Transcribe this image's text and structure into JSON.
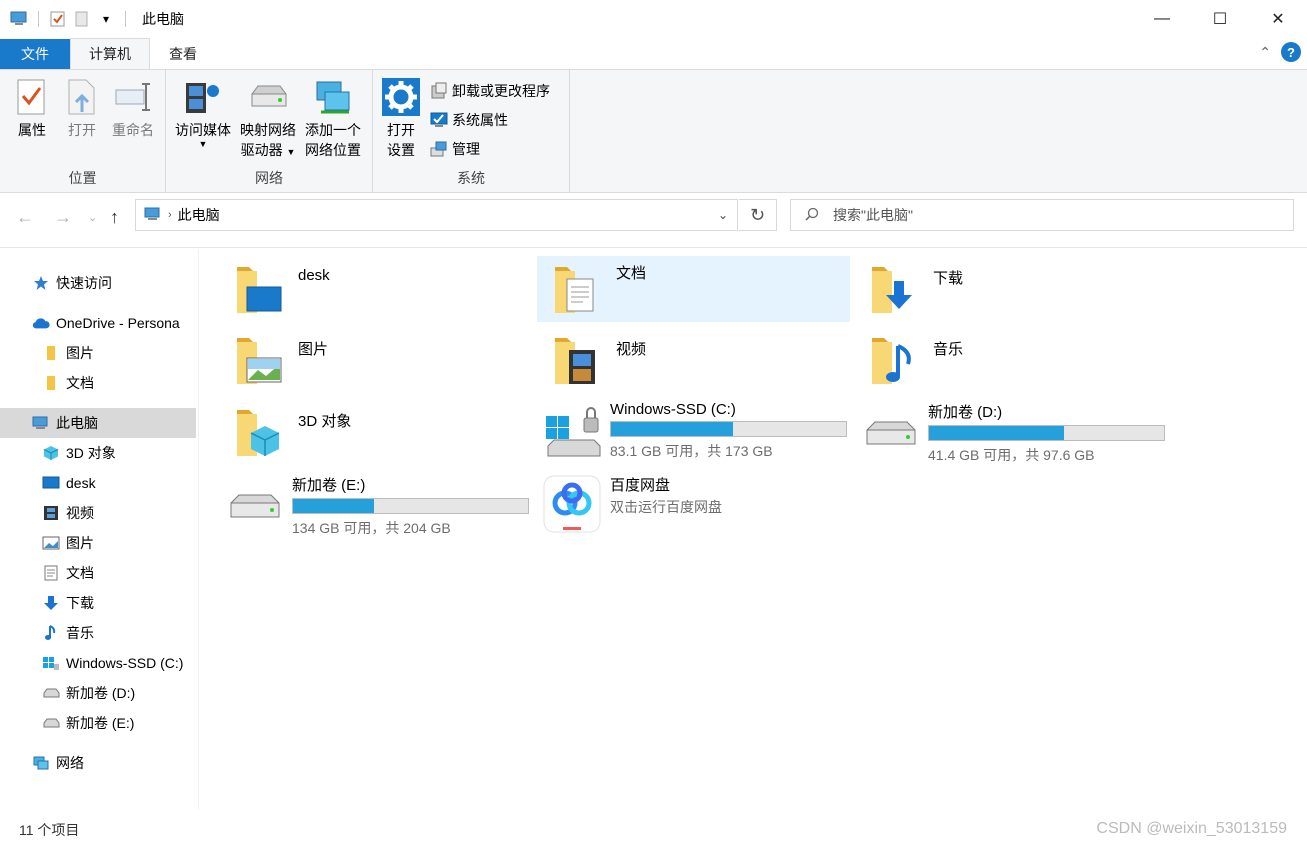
{
  "window": {
    "title": "此电脑",
    "qat_dropdown": "▾",
    "controls": {
      "minimize": "—",
      "maximize": "☐",
      "close": "✕"
    }
  },
  "tabs": [
    {
      "label": "文件"
    },
    {
      "label": "计算机"
    },
    {
      "label": "查看"
    }
  ],
  "ribbon": {
    "groups": {
      "location": "位置",
      "network": "网络",
      "system": "系统"
    },
    "buttons": {
      "properties": "属性",
      "open": "打开",
      "rename": "重命名",
      "access_media": "访问媒体",
      "map_drive_line1": "映射网络",
      "map_drive_line2": "驱动器",
      "add_location_line1": "添加一个",
      "add_location_line2": "网络位置",
      "open_settings_line1": "打开",
      "open_settings_line2": "设置",
      "uninstall": "卸载或更改程序",
      "system_props": "系统属性",
      "manage": "管理"
    }
  },
  "address": {
    "path": "此电脑",
    "search_placeholder": "搜索\"此电脑\""
  },
  "nav": [
    {
      "label": "快速访问",
      "icon": "star-icon"
    },
    {
      "label": "OneDrive - Persona",
      "icon": "cloud-icon"
    },
    {
      "label": "图片",
      "icon": "folder-icon"
    },
    {
      "label": "文档",
      "icon": "folder-icon"
    },
    {
      "label": "此电脑",
      "icon": "computer-icon"
    },
    {
      "label": "3D 对象",
      "icon": "cube-icon"
    },
    {
      "label": "desk",
      "icon": "desktop-icon"
    },
    {
      "label": "视频",
      "icon": "film-icon"
    },
    {
      "label": "图片",
      "icon": "picture-icon"
    },
    {
      "label": "文档",
      "icon": "document-icon"
    },
    {
      "label": "下载",
      "icon": "download-icon"
    },
    {
      "label": "音乐",
      "icon": "music-icon"
    },
    {
      "label": "Windows-SSD (C:)",
      "icon": "windows-drive-icon"
    },
    {
      "label": "新加卷 (D:)",
      "icon": "drive-icon"
    },
    {
      "label": "新加卷 (E:)",
      "icon": "drive-icon"
    },
    {
      "label": "网络",
      "icon": "network-icon"
    }
  ],
  "folders": [
    {
      "name": "desk"
    },
    {
      "name": "文档"
    },
    {
      "name": "下载"
    },
    {
      "name": "图片"
    },
    {
      "name": "视频"
    },
    {
      "name": "音乐"
    },
    {
      "name": "3D 对象"
    }
  ],
  "drives": [
    {
      "name": "Windows-SSD (C:)",
      "free": "83.1 GB 可用，共 173 GB",
      "used_fraction": 0.52
    },
    {
      "name": "新加卷 (D:)",
      "free": "41.4 GB 可用，共 97.6 GB",
      "used_fraction": 0.576
    },
    {
      "name": "新加卷 (E:)",
      "free": "134 GB 可用，共 204 GB",
      "used_fraction": 0.343
    }
  ],
  "app": {
    "name": "百度网盘",
    "subtitle": "双击运行百度网盘"
  },
  "status": {
    "count": "11 个项目",
    "watermark": "CSDN @weixin_53013159"
  },
  "colors": {
    "accent": "#1979ca",
    "drive_bar": "#26a0da",
    "selection": "#e5f3ff"
  }
}
